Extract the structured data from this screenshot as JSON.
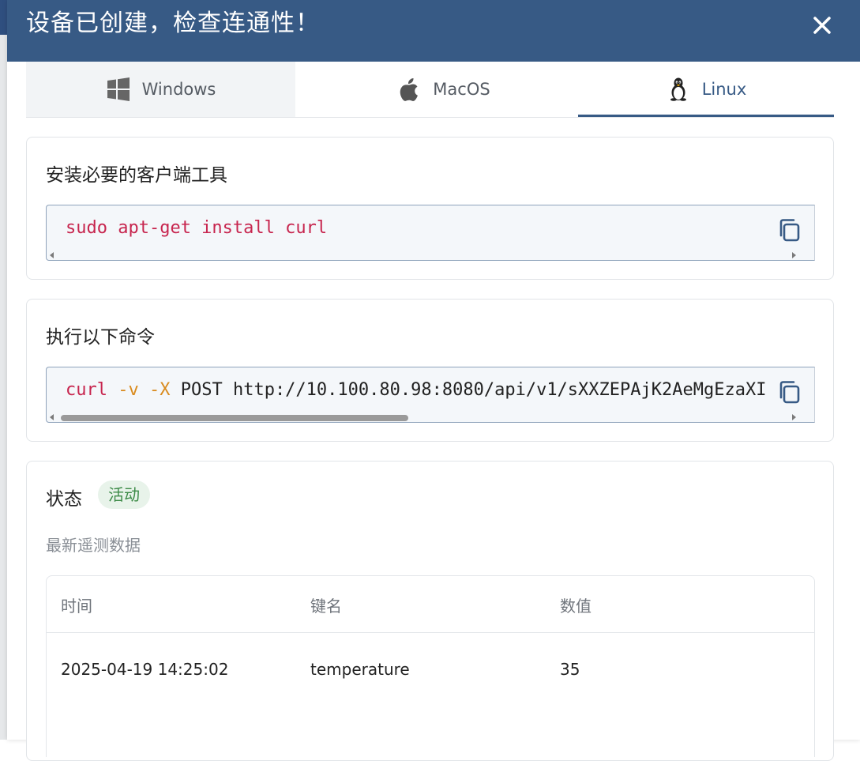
{
  "dialog": {
    "title": "设备已创建，检查连通性！",
    "close_icon": "close-icon"
  },
  "tabs": [
    {
      "label": "Windows",
      "icon": "windows-icon",
      "active": false
    },
    {
      "label": "MacOS",
      "icon": "apple-icon",
      "active": false
    },
    {
      "label": "Linux",
      "icon": "linux-tux-icon",
      "active": true
    }
  ],
  "install_card": {
    "title": "安装必要的客户端工具",
    "command": {
      "cmd": "sudo apt-get install curl"
    }
  },
  "run_card": {
    "title": "执行以下命令",
    "command": {
      "cmd": "curl",
      "flag_v": "-v",
      "flag_x": "-X",
      "rest": "POST http://10.100.80.98:8080/api/v1/sXXZEPAjK2AeMgEzaXI"
    }
  },
  "status_card": {
    "status_label": "状态",
    "status_value": "活动",
    "telemetry_title": "最新遥测数据",
    "table": {
      "headers": [
        "时间",
        "键名",
        "数值"
      ],
      "rows": [
        [
          "2025-04-19 14:25:02",
          "temperature",
          "35"
        ]
      ]
    }
  },
  "colors": {
    "header_bg": "#375a85",
    "accent": "#375a85",
    "keyword": "#c7254e",
    "flag": "#d98b1e",
    "status_bg": "#e8f3ea",
    "status_text": "#3b8a46"
  }
}
